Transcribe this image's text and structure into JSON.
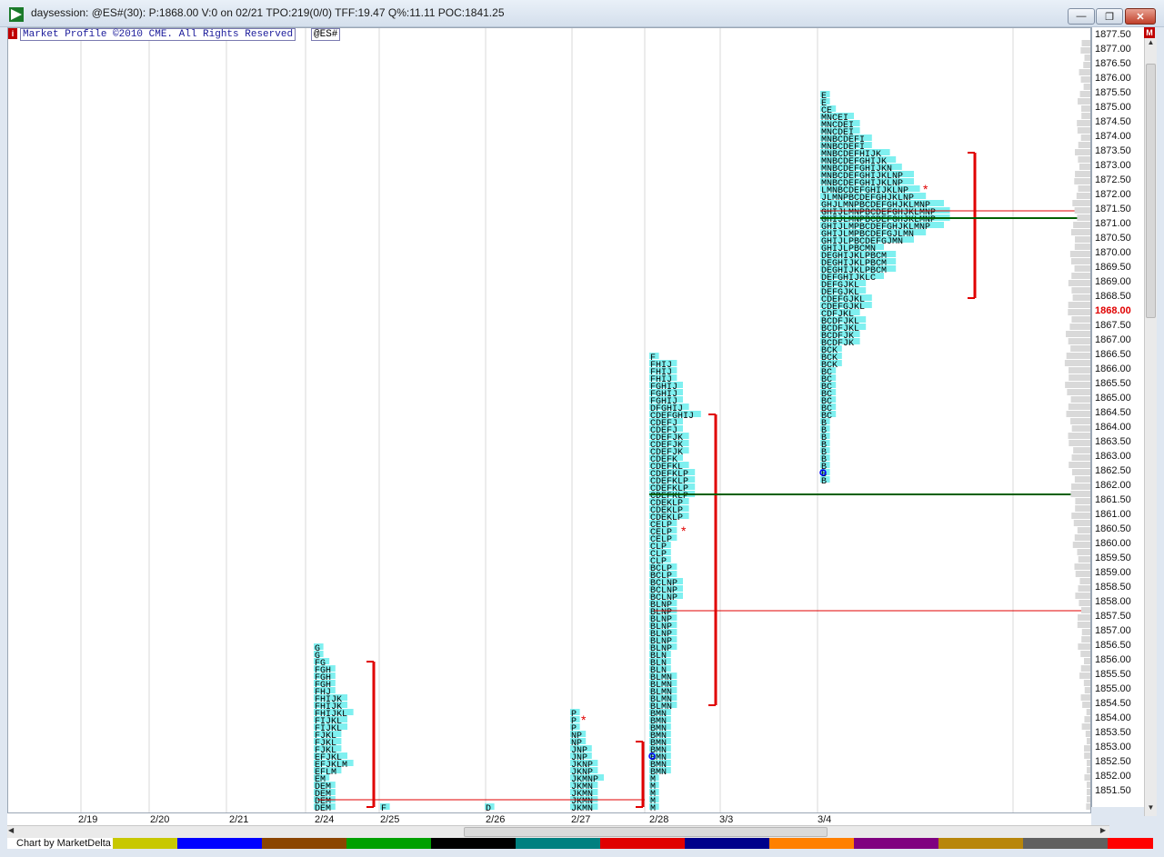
{
  "window": {
    "title": "daysession: @ES#(30): P:1868.00 V:0 on 02/21 TPO:219(0/0) TFF:19.47 Q%:11.11 POC:1841.25",
    "buttons": {
      "minimize": "—",
      "maximize": "❐",
      "close": "✕"
    }
  },
  "header": {
    "info_badge": "i",
    "copyright": "Market Profile ©2010 CME. All Rights Reserved",
    "symbol": "@ES#",
    "m_badge": "M"
  },
  "price_axis": {
    "labels": [
      "1877.50",
      "1877.00",
      "1876.50",
      "1876.00",
      "1875.50",
      "1875.00",
      "1874.50",
      "1874.00",
      "1873.50",
      "1873.00",
      "1872.50",
      "1872.00",
      "1871.50",
      "1871.00",
      "1870.50",
      "1870.00",
      "1869.50",
      "1869.00",
      "1868.50",
      "1868.00",
      "1867.50",
      "1867.00",
      "1866.50",
      "1866.00",
      "1865.50",
      "1865.00",
      "1864.50",
      "1864.00",
      "1863.50",
      "1863.00",
      "1862.50",
      "1862.00",
      "1861.50",
      "1861.00",
      "1860.50",
      "1860.00",
      "1859.50",
      "1859.00",
      "1858.50",
      "1858.00",
      "1857.50",
      "1857.00",
      "1856.50",
      "1856.00",
      "1855.50",
      "1855.00",
      "1854.50",
      "1854.00",
      "1853.50",
      "1853.00",
      "1852.50",
      "1852.00",
      "1851.50"
    ],
    "current_price": "1868.00"
  },
  "date_axis": {
    "labels": [
      "2/19",
      "2/20",
      "2/21",
      "2/24",
      "2/25",
      "2/26",
      "2/27",
      "2/28",
      "3/3",
      "3/4"
    ]
  },
  "footer": {
    "chart_by": "Chart by MarketDelta",
    "strip_colors": [
      "#ffffff",
      "#c8c800",
      "#0000ff",
      "#8b4500",
      "#00a000",
      "#000000",
      "#008080",
      "#e00000",
      "#00008b",
      "#ff8000",
      "#800080",
      "#b8860b",
      "#606060",
      "#ff0000"
    ]
  },
  "profiles": [
    {
      "date": "2/24",
      "rows": [
        {
          "p": "1856.5",
          "t": "G"
        },
        {
          "p": "1856.25",
          "t": "G"
        },
        {
          "p": "1856.0",
          "t": "FG"
        },
        {
          "p": "1855.75",
          "t": "FGH"
        },
        {
          "p": "1855.5",
          "t": "FGH"
        },
        {
          "p": "1855.25",
          "t": "FGH"
        },
        {
          "p": "1855.0",
          "t": "FHJ"
        },
        {
          "p": "1854.75",
          "t": "FHIJK"
        },
        {
          "p": "1854.5",
          "t": "FHIJK"
        },
        {
          "p": "1854.25",
          "t": "FHIJKL"
        },
        {
          "p": "1854.0",
          "t": "FIJKL"
        },
        {
          "p": "1853.75",
          "t": "FIJKL"
        },
        {
          "p": "1853.5",
          "t": "FJKL"
        },
        {
          "p": "1853.25",
          "t": "FJKL"
        },
        {
          "p": "1853.0",
          "t": "FJKL"
        },
        {
          "p": "1852.75",
          "t": "EFJKL"
        },
        {
          "p": "1852.5",
          "t": "EFJKLM"
        },
        {
          "p": "1852.25",
          "t": "EFLM"
        },
        {
          "p": "1852.0",
          "t": "EM"
        },
        {
          "p": "1851.75",
          "t": "DEM"
        },
        {
          "p": "1851.5",
          "t": "DEM"
        },
        {
          "p": "1851.25",
          "t": "DEM"
        },
        {
          "p": "1851.0",
          "t": "DEM"
        }
      ]
    },
    {
      "date": "2/25",
      "rows": [
        {
          "p": "1851.0",
          "t": "F"
        }
      ]
    },
    {
      "date": "2/26",
      "rows": [
        {
          "p": "1851.0",
          "t": "D"
        }
      ]
    },
    {
      "date": "2/27",
      "rows": [
        {
          "p": "1854.25",
          "t": "P"
        },
        {
          "p": "1854.0",
          "t": "P"
        },
        {
          "p": "1853.75",
          "t": "P"
        },
        {
          "p": "1853.5",
          "t": "NP"
        },
        {
          "p": "1853.25",
          "t": "NP"
        },
        {
          "p": "1853.0",
          "t": "JNP"
        },
        {
          "p": "1852.75",
          "t": "JNP"
        },
        {
          "p": "1852.5",
          "t": "JKNP"
        },
        {
          "p": "1852.25",
          "t": "JKNP"
        },
        {
          "p": "1852.0",
          "t": "JKMNP"
        },
        {
          "p": "1851.75",
          "t": "JKMN"
        },
        {
          "p": "1851.5",
          "t": "JKMN"
        },
        {
          "p": "1851.25",
          "t": "JKMN"
        },
        {
          "p": "1851.0",
          "t": "JKMN"
        }
      ]
    },
    {
      "date": "2/28",
      "rows": [
        {
          "p": "1866.5",
          "t": "F"
        },
        {
          "p": "1866.25",
          "t": "FHIJ"
        },
        {
          "p": "1866.0",
          "t": "FHIJ"
        },
        {
          "p": "1865.75",
          "t": "FHIJ"
        },
        {
          "p": "1865.5",
          "t": "FGHIJ"
        },
        {
          "p": "1865.25",
          "t": "FGHIJ"
        },
        {
          "p": "1865.0",
          "t": "FGHIJ"
        },
        {
          "p": "1864.75",
          "t": "DFGHIJ"
        },
        {
          "p": "1864.5",
          "t": "CDEFGHIJ"
        },
        {
          "p": "1864.25",
          "t": "CDEFJ"
        },
        {
          "p": "1864.0",
          "t": "CDEFJ"
        },
        {
          "p": "1863.75",
          "t": "CDEFJK"
        },
        {
          "p": "1863.5",
          "t": "CDEFJK"
        },
        {
          "p": "1863.25",
          "t": "CDEFJK"
        },
        {
          "p": "1863.0",
          "t": "CDEFK"
        },
        {
          "p": "1862.75",
          "t": "CDEFKL"
        },
        {
          "p": "1862.5",
          "t": "CDEFKLP"
        },
        {
          "p": "1862.25",
          "t": "CDEFKLP"
        },
        {
          "p": "1862.0",
          "t": "CDEFKLP"
        },
        {
          "p": "1861.75",
          "t": "CDEFKLP"
        },
        {
          "p": "1861.5",
          "t": "CDEKLP"
        },
        {
          "p": "1861.25",
          "t": "CDEKLP"
        },
        {
          "p": "1861.0",
          "t": "CDEKLP"
        },
        {
          "p": "1860.75",
          "t": "CELP"
        },
        {
          "p": "1860.5",
          "t": "CELP"
        },
        {
          "p": "1860.25",
          "t": "CELP"
        },
        {
          "p": "1860.0",
          "t": "CLP"
        },
        {
          "p": "1859.75",
          "t": "CLP"
        },
        {
          "p": "1859.5",
          "t": "CLP"
        },
        {
          "p": "1859.25",
          "t": "BCLP"
        },
        {
          "p": "1859.0",
          "t": "BCLP"
        },
        {
          "p": "1858.75",
          "t": "BCLNP"
        },
        {
          "p": "1858.5",
          "t": "BCLNP"
        },
        {
          "p": "1858.25",
          "t": "BCLNP"
        },
        {
          "p": "1858.0",
          "t": "BLNP"
        },
        {
          "p": "1857.75",
          "t": "BLNP"
        },
        {
          "p": "1857.5",
          "t": "BLNP"
        },
        {
          "p": "1857.25",
          "t": "BLNP"
        },
        {
          "p": "1857.0",
          "t": "BLNP"
        },
        {
          "p": "1856.75",
          "t": "BLNP"
        },
        {
          "p": "1856.5",
          "t": "BLNP"
        },
        {
          "p": "1856.25",
          "t": "BLN"
        },
        {
          "p": "1856.0",
          "t": "BLN"
        },
        {
          "p": "1855.75",
          "t": "BLN"
        },
        {
          "p": "1855.5",
          "t": "BLMN"
        },
        {
          "p": "1855.25",
          "t": "BLMN"
        },
        {
          "p": "1855.0",
          "t": "BLMN"
        },
        {
          "p": "1854.75",
          "t": "BLMN"
        },
        {
          "p": "1854.5",
          "t": "BLMN"
        },
        {
          "p": "1854.25",
          "t": "BMN"
        },
        {
          "p": "1854.0",
          "t": "BMN"
        },
        {
          "p": "1853.75",
          "t": "BMN"
        },
        {
          "p": "1853.5",
          "t": "BMN"
        },
        {
          "p": "1853.25",
          "t": "BMN"
        },
        {
          "p": "1853.0",
          "t": "BMN"
        },
        {
          "p": "1852.75",
          "t": "BMN"
        },
        {
          "p": "1852.5",
          "t": "BMN"
        },
        {
          "p": "1852.25",
          "t": "BMN"
        },
        {
          "p": "1852.0",
          "t": "M"
        },
        {
          "p": "1851.75",
          "t": "M"
        },
        {
          "p": "1851.5",
          "t": "M"
        },
        {
          "p": "1851.25",
          "t": "M"
        },
        {
          "p": "1851.0",
          "t": "M"
        }
      ]
    },
    {
      "date": "3/4",
      "rows": [
        {
          "p": "1875.5",
          "t": "E"
        },
        {
          "p": "1875.25",
          "t": "E"
        },
        {
          "p": "1875.0",
          "t": "CE"
        },
        {
          "p": "1874.75",
          "t": "MNCEI"
        },
        {
          "p": "1874.5",
          "t": "MNCDEI"
        },
        {
          "p": "1874.25",
          "t": "MNCDEI"
        },
        {
          "p": "1874.0",
          "t": "MNBCDEFI"
        },
        {
          "p": "1873.75",
          "t": "MNBCDEFI"
        },
        {
          "p": "1873.5",
          "t": "MNBCDEFHIJK"
        },
        {
          "p": "1873.25",
          "t": "MNBCDEFGHIJK"
        },
        {
          "p": "1873.0",
          "t": "MNBCDEFGHIJKN"
        },
        {
          "p": "1872.75",
          "t": "MNBCDEFGHIJKLNP"
        },
        {
          "p": "1872.5",
          "t": "MNBCDEFGHIJKLNP"
        },
        {
          "p": "1872.25",
          "t": "LMNBCDEFGHIJKLNP"
        },
        {
          "p": "1872.0",
          "t": "JLMNPBCDEFGHJKLNP"
        },
        {
          "p": "1871.75",
          "t": "GHJLMNPBCDEFGHJKLMNP"
        },
        {
          "p": "1871.5",
          "t": "GHIJLMNPBCDEFGHJKLMNP"
        },
        {
          "p": "1871.25",
          "t": "GHIJLMNPBCDEFGHJKLMNP"
        },
        {
          "p": "1871.0",
          "t": "GHIJLMPBCDEFGHJKLMNP"
        },
        {
          "p": "1870.75",
          "t": "GHIJLMPBCDEFGJLMN"
        },
        {
          "p": "1870.5",
          "t": "GHIJLPBCDEFGJMN"
        },
        {
          "p": "1870.25",
          "t": "GHIJLPBCMN"
        },
        {
          "p": "1870.0",
          "t": "DEGHIJKLPBCM"
        },
        {
          "p": "1869.75",
          "t": "DEGHIJKLPBCM"
        },
        {
          "p": "1869.5",
          "t": "DEGHIJKLPBCM"
        },
        {
          "p": "1869.25",
          "t": "DEFGHIJKLC"
        },
        {
          "p": "1869.0",
          "t": "DEFGJKL"
        },
        {
          "p": "1868.75",
          "t": "DEFGJKL"
        },
        {
          "p": "1868.5",
          "t": "CDEFGJKL"
        },
        {
          "p": "1868.25",
          "t": "CDEFGJKL"
        },
        {
          "p": "1868.0",
          "t": "CDFJKL"
        },
        {
          "p": "1867.75",
          "t": "BCDFJKL"
        },
        {
          "p": "1867.5",
          "t": "BCDFJKL"
        },
        {
          "p": "1867.25",
          "t": "BCDFJK"
        },
        {
          "p": "1867.0",
          "t": "BCDFJK"
        },
        {
          "p": "1866.75",
          "t": "BCK"
        },
        {
          "p": "1866.5",
          "t": "BCK"
        },
        {
          "p": "1866.25",
          "t": "BCK"
        },
        {
          "p": "1866.0",
          "t": "BC"
        },
        {
          "p": "1865.75",
          "t": "BC"
        },
        {
          "p": "1865.5",
          "t": "BC"
        },
        {
          "p": "1865.25",
          "t": "BC"
        },
        {
          "p": "1865.0",
          "t": "BC"
        },
        {
          "p": "1864.75",
          "t": "BC"
        },
        {
          "p": "1864.5",
          "t": "BC"
        },
        {
          "p": "1864.25",
          "t": "B"
        },
        {
          "p": "1864.0",
          "t": "B"
        },
        {
          "p": "1863.75",
          "t": "B"
        },
        {
          "p": "1863.5",
          "t": "B"
        },
        {
          "p": "1863.25",
          "t": "B"
        },
        {
          "p": "1863.0",
          "t": "B"
        },
        {
          "p": "1862.75",
          "t": "B"
        },
        {
          "p": "1862.5",
          "t": "B"
        },
        {
          "p": "1862.25",
          "t": "B"
        }
      ]
    }
  ]
}
